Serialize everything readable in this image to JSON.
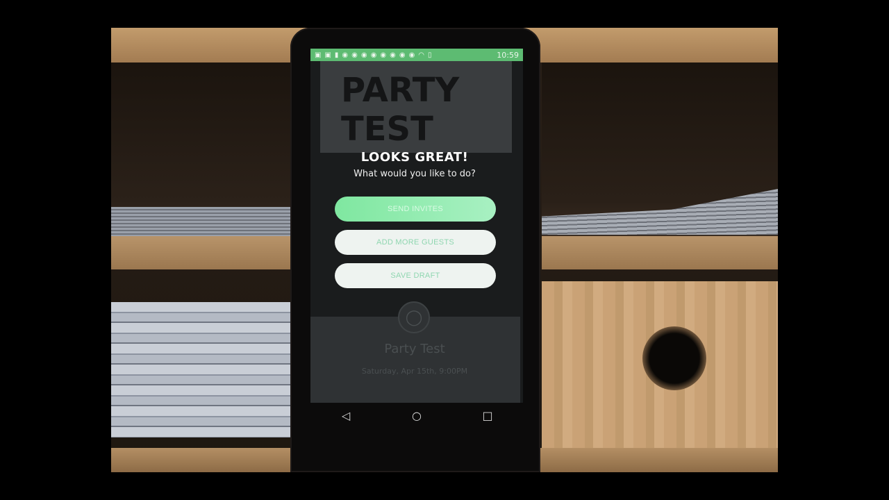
{
  "statusbar": {
    "time": "10:59"
  },
  "background_card": {
    "title_line1": "PARTY",
    "title_line2": "TEST"
  },
  "dialog": {
    "title": "LOOKS GREAT!",
    "subtitle": "What would you like to do?",
    "send_label": "SEND INVITES",
    "add_label": "ADD MORE GUESTS",
    "save_label": "SAVE DRAFT"
  },
  "event_card": {
    "name": "Party Test",
    "date": "Saturday, Apr 15th, 9:00PM"
  },
  "navbar": {
    "back": "◁",
    "home": "○",
    "recents": "□"
  },
  "colors": {
    "statusbar": "#5dbb72",
    "accent": "#7fe7a0",
    "button_text": "#8fd6b0"
  }
}
